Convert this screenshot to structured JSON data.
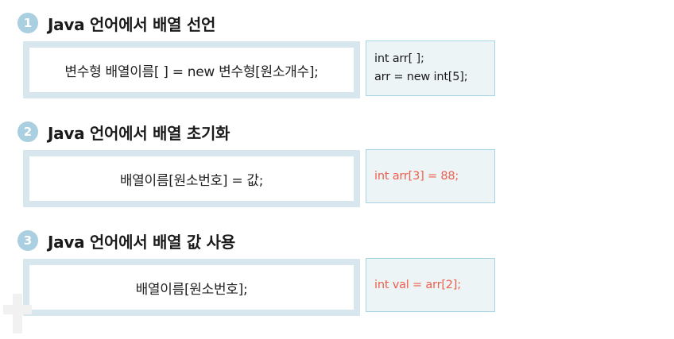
{
  "sections": [
    {
      "number": "1",
      "title": "Java 언어에서 배열 선언",
      "syntax": "변수형 배열이름[ ] = new 변수형[원소개수];",
      "example_lines": [
        "int arr[ ];",
        "arr = new int[5];"
      ]
    },
    {
      "number": "2",
      "title": "Java 언어에서 배열 초기화",
      "syntax": "배열이름[원소번호] = 값;",
      "example_lines": [
        "int arr[3] = 88;"
      ]
    },
    {
      "number": "3",
      "title": "Java 언어에서 배열 값 사용",
      "syntax": "배열이름[원소번호];",
      "example_lines": [
        "int val = arr[2];"
      ]
    }
  ],
  "colors": {
    "number_badge": "#a9cfe0",
    "syntax_border": "#d8e7ee",
    "example_bg": "#edf4f6",
    "example_border": "#a8d3e3",
    "accent_code": "#ee5e4c"
  }
}
